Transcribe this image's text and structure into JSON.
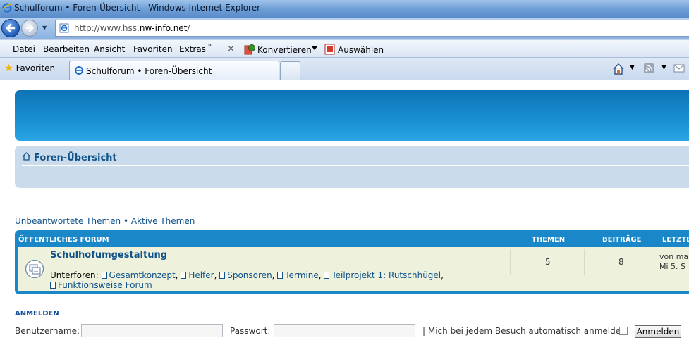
{
  "window": {
    "title": "Schulforum • Foren-Übersicht - Windows Internet Explorer"
  },
  "address_bar": {
    "url_prefix": "http://www.hss.",
    "url_domain": "nw-info.net",
    "url_suffix": "/"
  },
  "menu": {
    "items": [
      "Datei",
      "Bearbeiten",
      "Ansicht",
      "Favoriten",
      "Extras"
    ],
    "overflow": "»",
    "close": "×",
    "convert_label": "Konvertieren",
    "select_label": "Auswählen"
  },
  "tabs": {
    "favorites_label": "Favoriten",
    "active_tab_title": "Schulforum • Foren-Übersicht"
  },
  "page": {
    "breadcrumb": "Foren-Übersicht",
    "quicklinks": {
      "unanswered": "Unbeantwortete Themen",
      "separator": " • ",
      "active": "Aktive Themen"
    },
    "forum_table": {
      "header_category": "ÖFFENTLICHES FORUM",
      "header_topics": "THEMEN",
      "header_posts": "BEITRÄGE",
      "header_last": "LETZTE",
      "forum": {
        "title": "Schulhofumgestaltung",
        "subforums_label": "Unterforen:",
        "subforums": [
          "Gesamtkonzept",
          "Helfer",
          "Sponsoren",
          "Termine",
          "Teilprojekt 1: Rutschhügel",
          "Funktionsweise Forum"
        ],
        "topics": "5",
        "posts": "8",
        "last_line1": "von ma",
        "last_line2": "Mi 5. S"
      }
    },
    "login": {
      "heading": "ANMELDEN",
      "username_label": "Benutzername:",
      "password_label": "Passwort:",
      "auto_login_label": "| Mich bei jedem Besuch automatisch anmelden",
      "submit_label": "Anmelden",
      "username_value": "",
      "password_value": ""
    }
  },
  "colors": {
    "link": "#105289",
    "header_blue": "#1a88c8",
    "row_bg": "#eef2dc",
    "breadcrumb_bg": "#cadceb"
  }
}
